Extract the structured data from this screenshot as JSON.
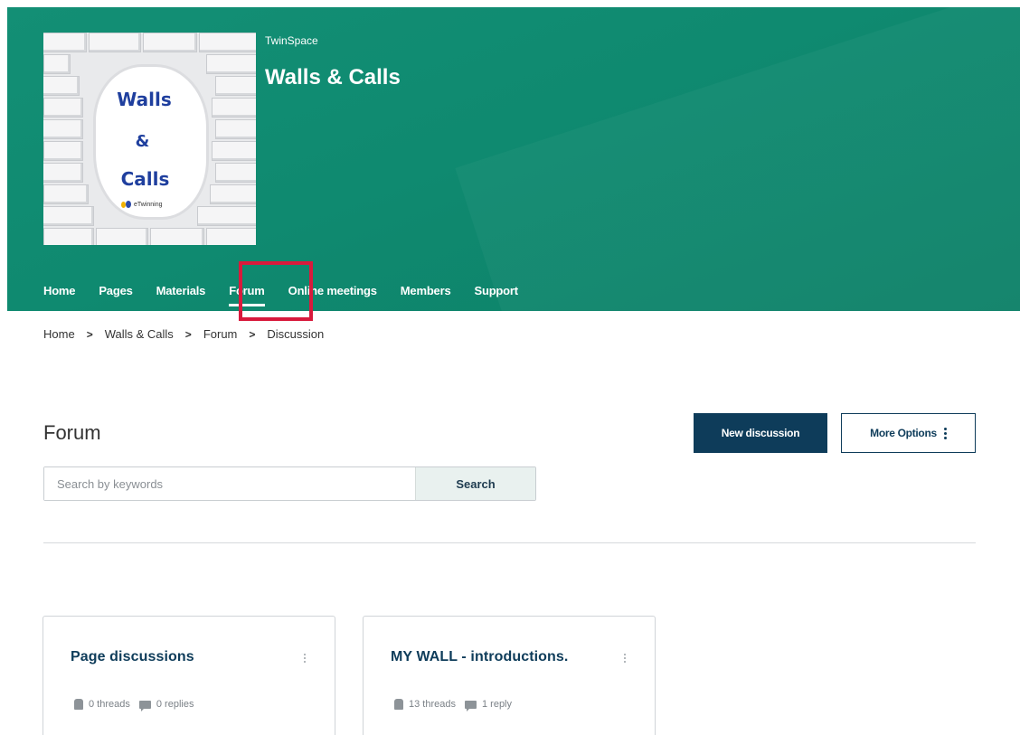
{
  "header": {
    "section_label": "TwinSpace",
    "project_title": "Walls & Calls",
    "logo": {
      "line1": "Walls",
      "line2": "&",
      "line3": "Calls",
      "brand_text": "eTwinning"
    },
    "nav": [
      {
        "label": "Home",
        "active": false
      },
      {
        "label": "Pages",
        "active": false
      },
      {
        "label": "Materials",
        "active": false
      },
      {
        "label": "Forum",
        "active": true
      },
      {
        "label": "Online meetings",
        "active": false
      },
      {
        "label": "Members",
        "active": false
      },
      {
        "label": "Support",
        "active": false
      }
    ],
    "colors": {
      "hero_bg": "#0f8a70",
      "highlight": "#d81a3c"
    }
  },
  "breadcrumb": {
    "items": [
      "Home",
      "Walls & Calls",
      "Forum",
      "Discussion"
    ],
    "separator": ">"
  },
  "main": {
    "title": "Forum",
    "new_discussion_label": "New discussion",
    "more_options_label": "More Options",
    "search": {
      "placeholder": "Search by keywords",
      "value": "",
      "button_label": "Search"
    },
    "cards": [
      {
        "title": "Page discussions",
        "threads": "0 threads",
        "replies": "0 replies"
      },
      {
        "title": "MY WALL - introductions.",
        "threads": "13 threads",
        "replies": "1 reply"
      }
    ],
    "colors": {
      "primary": "#0e3c5a"
    }
  }
}
